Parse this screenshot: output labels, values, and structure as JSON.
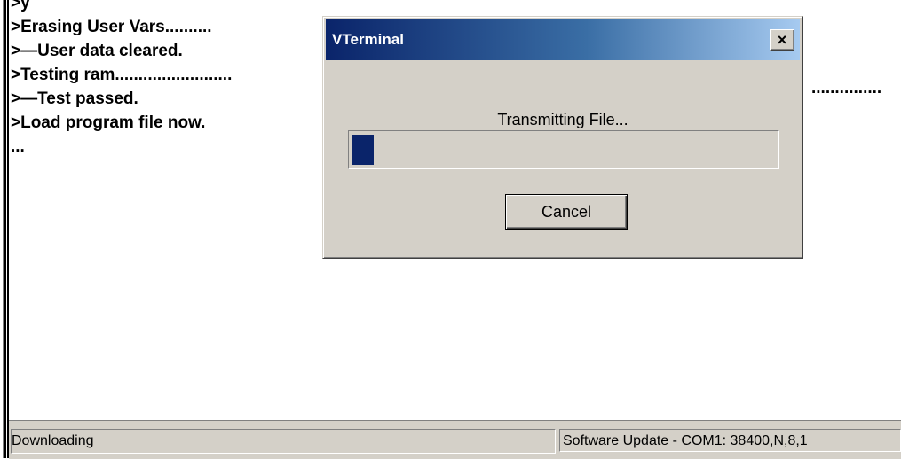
{
  "terminal": {
    "lines": [
      ">y",
      ">Erasing User Vars..........",
      ">—User data cleared.",
      ">Testing ram.........................",
      ">—Test passed.",
      ">Load program file now.",
      "..."
    ],
    "dots_right": "..............."
  },
  "dialog": {
    "title": "VTerminal",
    "close_label": "×",
    "message": "Transmitting File...",
    "progress_fraction": 0.05,
    "cancel_label": "Cancel"
  },
  "statusbar": {
    "left": "Downloading",
    "right": "Software Update - COM1: 38400,N,8,1"
  },
  "colors": {
    "titlebar_start": "#0a246a",
    "progress_fill": "#0a246a",
    "dialog_bg": "#d4d0c8"
  }
}
